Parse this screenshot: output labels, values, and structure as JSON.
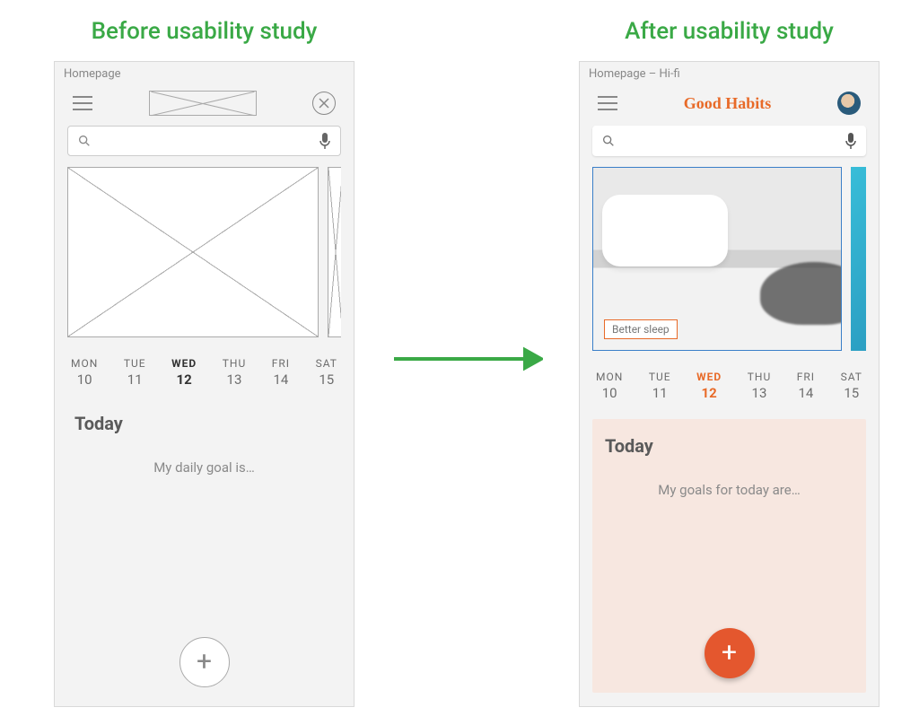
{
  "titles": {
    "before": "Before usability study",
    "after": "After usability study"
  },
  "lofi": {
    "frame_label": "Homepage",
    "calendar": [
      {
        "dow": "MON",
        "num": "10",
        "selected": false
      },
      {
        "dow": "TUE",
        "num": "11",
        "selected": false
      },
      {
        "dow": "WED",
        "num": "12",
        "selected": true
      },
      {
        "dow": "THU",
        "num": "13",
        "selected": false
      },
      {
        "dow": "FRI",
        "num": "14",
        "selected": false
      },
      {
        "dow": "SAT",
        "num": "15",
        "selected": false
      }
    ],
    "today_title": "Today",
    "today_subtitle": "My daily goal is…"
  },
  "hifi": {
    "frame_label": "Homepage – Hi-fi",
    "app_title": "Good Habits",
    "card_tag": "Better sleep",
    "calendar": [
      {
        "dow": "MON",
        "num": "10",
        "selected": false
      },
      {
        "dow": "TUE",
        "num": "11",
        "selected": false
      },
      {
        "dow": "WED",
        "num": "12",
        "selected": true
      },
      {
        "dow": "THU",
        "num": "13",
        "selected": false
      },
      {
        "dow": "FRI",
        "num": "14",
        "selected": false
      },
      {
        "dow": "SAT",
        "num": "15",
        "selected": false
      }
    ],
    "today_title": "Today",
    "today_subtitle": "My goals for today are…"
  },
  "colors": {
    "accent_green": "#3aa946",
    "accent_orange": "#e4572e",
    "brand_orange": "#e86a28"
  }
}
